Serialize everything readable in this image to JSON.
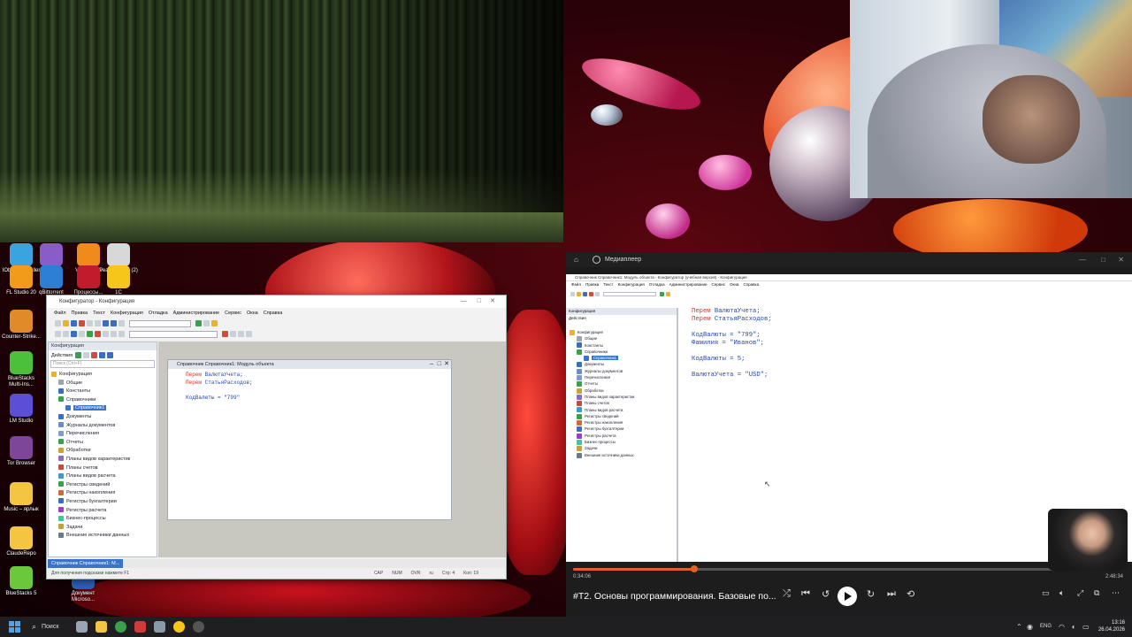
{
  "colors": {
    "accent": "#e0602a",
    "selection": "#3a74c8",
    "keyword": "#d0362a",
    "identifier": "#2a48a8",
    "taskbar": "#1f1f22"
  },
  "desktop_icons": [
    {
      "label": "IObit Uninstaller",
      "icon": "uninstaller-icon",
      "color": "#3aa3e0"
    },
    {
      "label": "MyFiles – ярлык",
      "icon": "folder-icon",
      "color": "#8a5cc8"
    },
    {
      "label": "VLC media player",
      "icon": "vlc-icon",
      "color": "#f08a1a"
    },
    {
      "label": "Реакция_н... (2)",
      "icon": "video-file-icon",
      "color": "#d8d8d8"
    },
    {
      "label": "FL Studio 20",
      "icon": "fl-studio-icon",
      "color": "#f29b1a"
    },
    {
      "label": "qBittorrent",
      "icon": "qbittorrent-icon",
      "color": "#2d7fd6"
    },
    {
      "label": "Процессы...",
      "icon": "processes-icon",
      "color": "#c21c2c"
    },
    {
      "label": "1С",
      "icon": "1c-icon",
      "color": "#f5c71a"
    },
    {
      "label": "Counter-Strike...",
      "icon": "cs-icon",
      "color": "#e08a2a"
    },
    {
      "label": "BlueStacks Multi-Ins...",
      "icon": "bluestacks-icon",
      "color": "#4bc03a"
    },
    {
      "label": "LM Studio",
      "icon": "lm-studio-icon",
      "color": "#5b4fd8"
    },
    {
      "label": "Tor Browser",
      "icon": "tor-icon",
      "color": "#7d4698"
    },
    {
      "label": "Music – ярлык",
      "icon": "music-folder-icon",
      "color": "#f4c542"
    },
    {
      "label": "ClaudeRepo",
      "icon": "folder-icon",
      "color": "#f4c542"
    },
    {
      "label": "BlueStacks 5",
      "icon": "bluestacks-icon",
      "color": "#6ac83a"
    },
    {
      "label": "Документ Microso...",
      "icon": "word-doc-icon",
      "color": "#2b5fb8"
    }
  ],
  "configurator_window": {
    "title": "Конфигуратор - Конфигурация",
    "menu": [
      "Файл",
      "Правка",
      "Текст",
      "Конфигурация",
      "Отладка",
      "Администрирование",
      "Сервис",
      "Окна",
      "Справка"
    ],
    "tree_title": "Конфигурация",
    "tree_actions": "Действия",
    "tree_search_placeholder": "Поиск (Ctrl+F)",
    "tree_items": [
      {
        "label": "Конфигурация",
        "level": 0,
        "color": "#e9b22f"
      },
      {
        "label": "Общие",
        "level": 1,
        "color": "#9aa5b1"
      },
      {
        "label": "Константы",
        "level": 1,
        "color": "#3a6fc0"
      },
      {
        "label": "Справочники",
        "level": 1,
        "color": "#3aa04b"
      },
      {
        "label": "Справочник1",
        "level": 2,
        "color": "#3a74c8",
        "selected": true
      },
      {
        "label": "Документы",
        "level": 1,
        "color": "#3a6fc0"
      },
      {
        "label": "Журналы документов",
        "level": 1,
        "color": "#6a8cc8"
      },
      {
        "label": "Перечисления",
        "level": 1,
        "color": "#8a9ac8"
      },
      {
        "label": "Отчеты",
        "level": 1,
        "color": "#3aa04b"
      },
      {
        "label": "Обработки",
        "level": 1,
        "color": "#d0a030"
      },
      {
        "label": "Планы видов характеристик",
        "level": 1,
        "color": "#8a6ac8"
      },
      {
        "label": "Планы счетов",
        "level": 1,
        "color": "#c84a3a"
      },
      {
        "label": "Планы видов расчета",
        "level": 1,
        "color": "#3a9ac8"
      },
      {
        "label": "Регистры сведений",
        "level": 1,
        "color": "#3aa04b"
      },
      {
        "label": "Регистры накопления",
        "level": 1,
        "color": "#d06a3a"
      },
      {
        "label": "Регистры бухгалтерии",
        "level": 1,
        "color": "#3a6fc0"
      },
      {
        "label": "Регистры расчета",
        "level": 1,
        "color": "#a03ac8"
      },
      {
        "label": "Бизнес-процессы",
        "level": 1,
        "color": "#3ac8a0"
      },
      {
        "label": "Задачи",
        "level": 1,
        "color": "#c8a03a"
      },
      {
        "label": "Внешние источники данных",
        "level": 1,
        "color": "#6a7a8a"
      }
    ],
    "module_window_title": "Справочник Справочник1: Модуль объекта",
    "code_lines": [
      {
        "kw": "Перем",
        "rest": " ВалютаУчета;"
      },
      {
        "kw": "Перем",
        "rest": " СтатьяРасходов;"
      },
      {
        "kw": "",
        "rest": ""
      },
      {
        "kw": "",
        "rest": "КодВалюты = \"799\""
      }
    ],
    "taskbar_tab": "Справочник Справочник1: М...",
    "status_hint": "Для получения подсказки нажмите F1",
    "status_indicators": [
      "CAP",
      "NUM",
      "OVR",
      "ru",
      "Стр: 4",
      "Кол: 19"
    ]
  },
  "media_player": {
    "app_title": "Медиаплеер",
    "inner_window_title": "Справочник Справочник1: Модуль объекта - Конфигуратор (учебная версия) - Конфигурация",
    "inner_menu": [
      "Файл",
      "Правка",
      "Текст",
      "Конфигурация",
      "Отладка",
      "Администрирование",
      "Сервис",
      "Окна",
      "Справка"
    ],
    "inner_tree_title": "Конфигурация",
    "inner_tree_actions": "Действия",
    "inner_tree_items": [
      {
        "label": "Конфигурация",
        "level": 0,
        "color": "#e9b22f"
      },
      {
        "label": "Общие",
        "level": 1,
        "color": "#9aa5b1"
      },
      {
        "label": "Константы",
        "level": 1,
        "color": "#3a6fc0"
      },
      {
        "label": "Справочники",
        "level": 1,
        "color": "#3aa04b"
      },
      {
        "label": "Справочник1",
        "level": 2,
        "color": "#3a74c8",
        "selected": true
      },
      {
        "label": "Документы",
        "level": 1,
        "color": "#3a6fc0"
      },
      {
        "label": "Журналы документов",
        "level": 1,
        "color": "#6a8cc8"
      },
      {
        "label": "Перечисления",
        "level": 1,
        "color": "#8a9ac8"
      },
      {
        "label": "Отчеты",
        "level": 1,
        "color": "#3aa04b"
      },
      {
        "label": "Обработки",
        "level": 1,
        "color": "#d0a030"
      },
      {
        "label": "Планы видов характеристик",
        "level": 1,
        "color": "#8a6ac8"
      },
      {
        "label": "Планы счетов",
        "level": 1,
        "color": "#c84a3a"
      },
      {
        "label": "Планы видов расчета",
        "level": 1,
        "color": "#3a9ac8"
      },
      {
        "label": "Регистры сведений",
        "level": 1,
        "color": "#3aa04b"
      },
      {
        "label": "Регистры накопления",
        "level": 1,
        "color": "#d06a3a"
      },
      {
        "label": "Регистры бухгалтерии",
        "level": 1,
        "color": "#3a6fc0"
      },
      {
        "label": "Регистры расчета",
        "level": 1,
        "color": "#a03ac8"
      },
      {
        "label": "Бизнес-процессы",
        "level": 1,
        "color": "#3ac8a0"
      },
      {
        "label": "Задачи",
        "level": 1,
        "color": "#c8a03a"
      },
      {
        "label": "Внешние источники данных",
        "level": 1,
        "color": "#6a7a8a"
      }
    ],
    "code_lines": [
      {
        "kw": "Перем",
        "rest": " ВалютаУчета;"
      },
      {
        "kw": "Перем",
        "rest": " СтатьяРасходов;"
      },
      {
        "kw": "",
        "rest": ""
      },
      {
        "kw": "",
        "rest": "КодВалюты = \"799\";"
      },
      {
        "kw": "",
        "rest": "Фамилия = \"Иванов\";"
      },
      {
        "kw": "",
        "rest": ""
      },
      {
        "kw": "",
        "rest": "КодВалюты = 5;"
      },
      {
        "kw": "",
        "rest": ""
      },
      {
        "kw": "",
        "rest": "ВалютаУчета = \"USD\";"
      }
    ],
    "time_elapsed": "0:34:06",
    "time_total": "2:48:34",
    "progress": 0.22,
    "video_title": "#Т2. Основы программирования. Базовые по...",
    "language": "ENG"
  },
  "taskbar": {
    "search_label": "Поиск",
    "pinned": [
      {
        "icon": "task-view-icon",
        "color": "#9aa5b1"
      },
      {
        "icon": "file-explorer-icon",
        "color": "#f4c542"
      },
      {
        "icon": "chrome-icon",
        "color": "#3aa04b"
      },
      {
        "icon": "vivaldi-icon",
        "color": "#d03a3a"
      },
      {
        "icon": "settings-icon",
        "color": "#8a9aa8"
      },
      {
        "icon": "1c-icon",
        "color": "#f5c71a"
      },
      {
        "icon": "obs-icon",
        "color": "#555555"
      }
    ],
    "language": "ENG",
    "time": "13:16",
    "date": "26.04.2026"
  }
}
